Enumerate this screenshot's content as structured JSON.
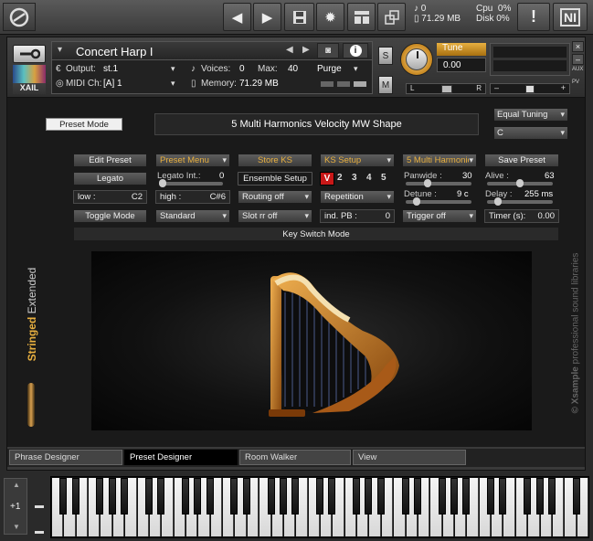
{
  "topbar": {
    "voices_count": "0",
    "memory": "71.29 MB",
    "cpu_label": "Cpu",
    "cpu_value": "0%",
    "disk_label": "Disk",
    "disk_value": "0%",
    "warning": "!"
  },
  "instrument": {
    "name": "Concert Harp I",
    "output_label": "Output:",
    "output_value": "st.1",
    "voices_label": "Voices:",
    "voices_value": "0",
    "max_label": "Max:",
    "max_value": "40",
    "purge_label": "Purge",
    "midi_label": "MIDI Ch:",
    "midi_value": "[A] 1",
    "memory_label": "Memory:",
    "memory_value": "71.29 MB",
    "tune_label": "Tune",
    "tune_value": "0.00",
    "s_label": "S",
    "m_label": "M",
    "l_label": "L",
    "r_label": "R",
    "aux_label": "AUX",
    "pv_label": "PV",
    "logo_text": "XAIL",
    "pan_fraction": 0.5,
    "volume_fraction": 0.5
  },
  "script": {
    "preset_mode_button": "Preset Mode",
    "preset_title": "5 Multi Harmonics Velocity MW Shape",
    "tuning": "Equal Tuning",
    "key": "C",
    "row1": {
      "edit_preset": "Edit Preset",
      "preset_menu": "Preset Menu",
      "store_ks": "Store KS",
      "ks_setup": "KS Setup",
      "multi_harmonics": "5 Multi Harmonics",
      "save_preset": "Save Preset"
    },
    "row2": {
      "legato": "Legato",
      "legato_int_label": "Legato Int.:",
      "legato_int_value": "0",
      "ensemble_setup": "Ensemble Setup",
      "v_button": "V",
      "numbers": [
        "2",
        "3",
        "4",
        "5"
      ],
      "panwide_label": "Panwide :",
      "panwide_value": "30",
      "alive_label": "Alive :",
      "alive_value": "63"
    },
    "row3": {
      "low_label": "low :",
      "low_value": "C2",
      "high_label": "high :",
      "high_value": "C#6",
      "routing": "Routing off",
      "repetition": "Repetition",
      "detune_label": "Detune :",
      "detune_value": "9 c",
      "delay_label": "Delay :",
      "delay_value": "255 ms"
    },
    "row4": {
      "toggle_mode": "Toggle Mode",
      "standard": "Standard",
      "slot_rr": "Slot rr off",
      "ind_pb_label": "ind. PB :",
      "ind_pb_value": "0",
      "trigger": "Trigger off",
      "timer_label": "Timer (s):",
      "timer_value": "0.00"
    },
    "key_switch_mode": "Key Switch Mode",
    "side_brand_bold": "Stringed",
    "side_brand_light": "Extended",
    "right_brand_bold": "© Xsample",
    "right_brand_light": "professional sound libraries"
  },
  "tabs": [
    "Phrase Designer",
    "Preset Designer",
    "Room Walker",
    "View"
  ],
  "keyboard": {
    "octave": "+1"
  },
  "colors": {
    "accent_orange": "#e8b040",
    "v_red": "#c81818",
    "panel_bg": "#1a1a1a"
  }
}
